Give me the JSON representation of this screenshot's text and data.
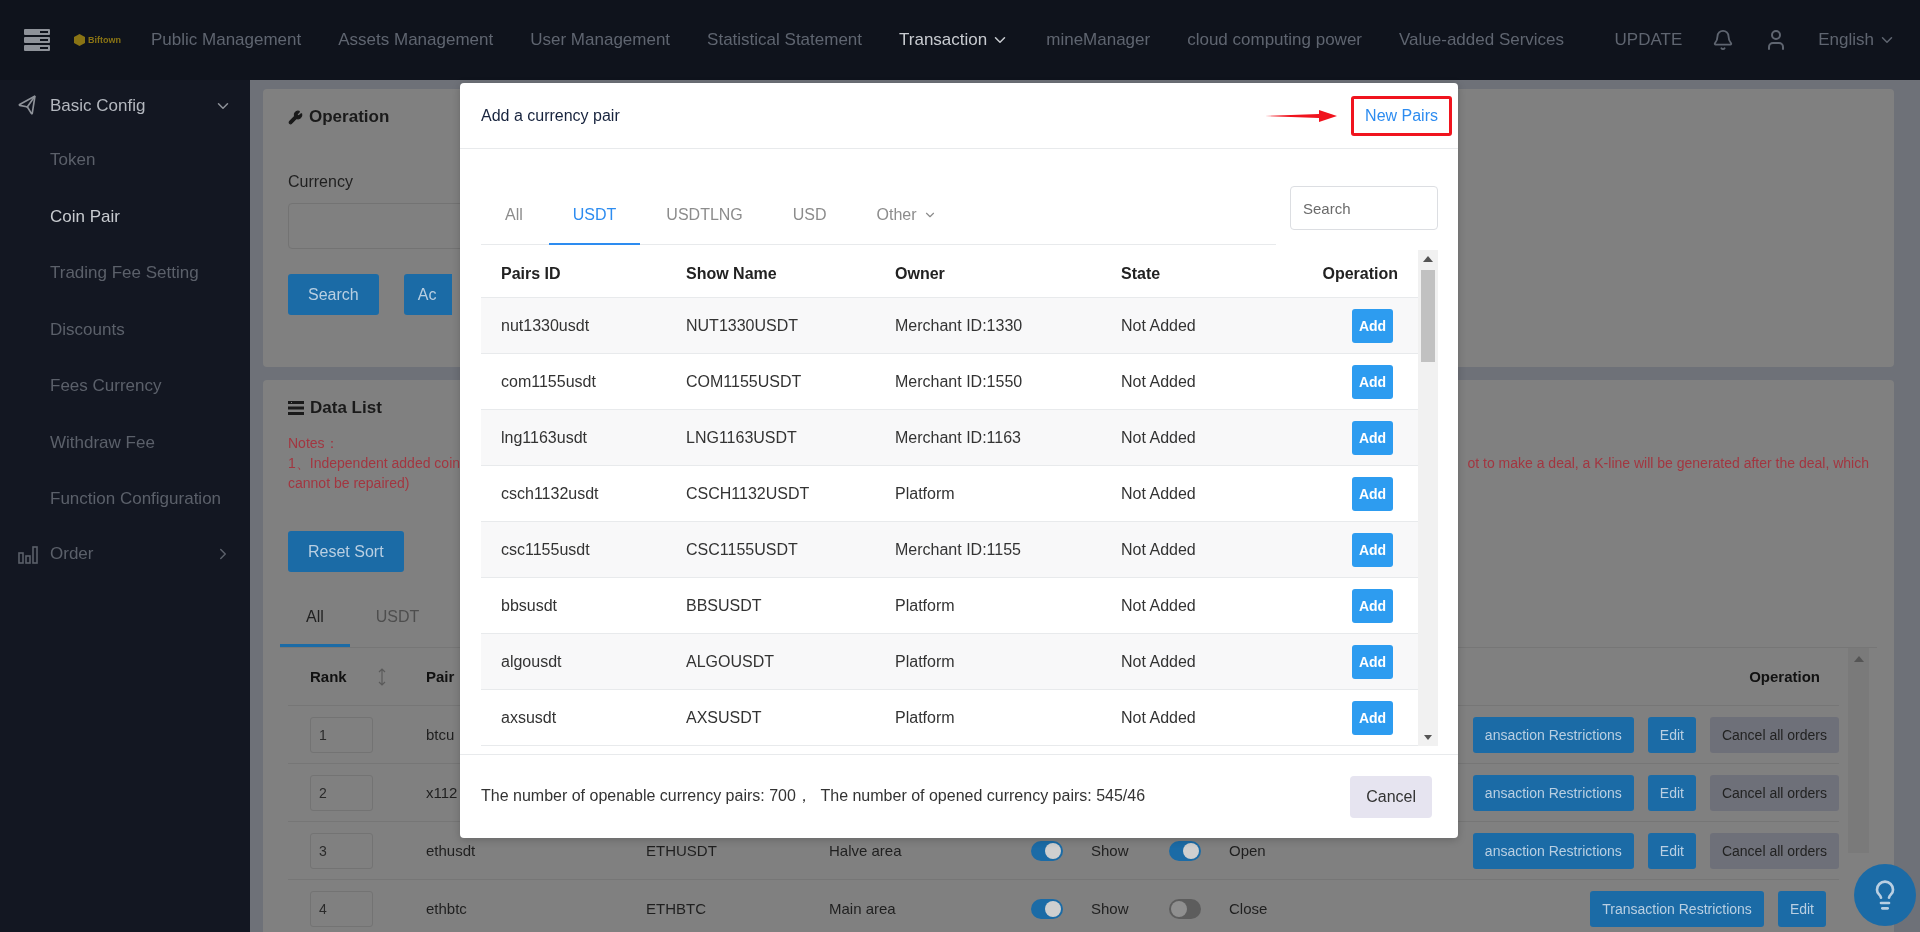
{
  "nav": {
    "logo_text": "Biftown",
    "menu": [
      {
        "label": "Public Management",
        "selected": false,
        "dropdown": false
      },
      {
        "label": "Assets Management",
        "selected": false,
        "dropdown": false
      },
      {
        "label": "User Management",
        "selected": false,
        "dropdown": false
      },
      {
        "label": "Statistical Statement",
        "selected": false,
        "dropdown": false
      },
      {
        "label": "Transaction",
        "selected": true,
        "dropdown": true
      },
      {
        "label": "mineManager",
        "selected": false,
        "dropdown": false
      },
      {
        "label": "cloud computing power",
        "selected": false,
        "dropdown": false
      },
      {
        "label": "Value-added Services",
        "selected": false,
        "dropdown": false
      }
    ],
    "update": "UPDATE",
    "language": "English"
  },
  "sidebar": {
    "groups": [
      {
        "label": "Basic Config",
        "expanded": true,
        "items": [
          {
            "label": "Token",
            "selected": false
          },
          {
            "label": "Coin Pair",
            "selected": true
          },
          {
            "label": "Trading Fee Setting",
            "selected": false
          },
          {
            "label": "Discounts",
            "selected": false
          },
          {
            "label": "Fees Currency",
            "selected": false
          },
          {
            "label": "Withdraw Fee",
            "selected": false
          },
          {
            "label": "Function Configuration",
            "selected": false
          }
        ]
      },
      {
        "label": "Order",
        "expanded": false
      }
    ]
  },
  "operation_panel": {
    "title": "Operation",
    "currency_label": "Currency",
    "buttons": [
      "Search",
      "Ac"
    ]
  },
  "data_panel": {
    "title": "Data List",
    "notes": {
      "heading": "Notes：",
      "line_1_left": "1、Independent added coin",
      "line_1_right": "ot to make a deal, a K-line will be generated after the deal, which",
      "line_2": "cannot be repaired)"
    },
    "reset_button": "Reset Sort",
    "tabs": [
      {
        "label": "All",
        "selected": true
      },
      {
        "label": "USDT",
        "selected": false
      }
    ],
    "columns": {
      "rank": "Rank",
      "pairs": "Pair",
      "operation": "Operation"
    },
    "rows": [
      {
        "rank": "1",
        "pair": "btcu",
        "actions": [
          {
            "label": "ansaction Restrictions",
            "kind": "primary"
          },
          {
            "label": "Edit",
            "kind": "primary"
          },
          {
            "label": "Cancel all orders",
            "kind": "secondary"
          }
        ]
      },
      {
        "rank": "2",
        "pair": "x112",
        "actions": [
          {
            "label": "ansaction Restrictions",
            "kind": "primary"
          },
          {
            "label": "Edit",
            "kind": "primary"
          },
          {
            "label": "Cancel all orders",
            "kind": "secondary"
          }
        ]
      },
      {
        "rank": "3",
        "pair": "ethusdt",
        "show_name": "ETHUSDT",
        "area": "Halve area",
        "show_toggle": {
          "on": true,
          "label": "Show"
        },
        "open_toggle": {
          "on": true,
          "label": "Open"
        },
        "actions": [
          {
            "label": "ansaction Restrictions",
            "kind": "primary"
          },
          {
            "label": "Edit",
            "kind": "primary"
          },
          {
            "label": "Cancel all orders",
            "kind": "secondary"
          }
        ]
      },
      {
        "rank": "4",
        "pair": "ethbtc",
        "show_name": "ETHBTC",
        "area": "Main area",
        "show_toggle": {
          "on": true,
          "label": "Show"
        },
        "open_toggle": {
          "on": false,
          "label": "Close"
        },
        "actions": [
          {
            "label": "Transaction Restrictions",
            "kind": "primary"
          },
          {
            "label": "Edit",
            "kind": "primary"
          }
        ]
      }
    ]
  },
  "modal": {
    "title": "Add a currency pair",
    "new_pairs_link": "New Pairs",
    "tabs": [
      {
        "label": "All",
        "selected": false,
        "dropdown": false
      },
      {
        "label": "USDT",
        "selected": true,
        "dropdown": false
      },
      {
        "label": "USDTLNG",
        "selected": false,
        "dropdown": false
      },
      {
        "label": "USD",
        "selected": false,
        "dropdown": false
      },
      {
        "label": "Other",
        "selected": false,
        "dropdown": true
      }
    ],
    "search": {
      "placeholder": "Search"
    },
    "columns": [
      "Pairs ID",
      "Show Name",
      "Owner",
      "State",
      "Operation"
    ],
    "rows": [
      {
        "pair_id": "nut1330usdt",
        "show_name": "NUT1330USDT",
        "owner": "Merchant ID:1330",
        "state": "Not Added",
        "action": "Add"
      },
      {
        "pair_id": "com1155usdt",
        "show_name": "COM1155USDT",
        "owner": "Merchant ID:1550",
        "state": "Not Added",
        "action": "Add"
      },
      {
        "pair_id": "lng1163usdt",
        "show_name": "LNG1163USDT",
        "owner": "Merchant ID:1163",
        "state": "Not Added",
        "action": "Add"
      },
      {
        "pair_id": "csch1132usdt",
        "show_name": "CSCH1132USDT",
        "owner": "Platform",
        "state": "Not Added",
        "action": "Add"
      },
      {
        "pair_id": "csc1155usdt",
        "show_name": "CSC1155USDT",
        "owner": "Merchant ID:1155",
        "state": "Not Added",
        "action": "Add"
      },
      {
        "pair_id": "bbsusdt",
        "show_name": "BBSUSDT",
        "owner": "Platform",
        "state": "Not Added",
        "action": "Add"
      },
      {
        "pair_id": "algousdt",
        "show_name": "ALGOUSDT",
        "owner": "Platform",
        "state": "Not Added",
        "action": "Add"
      },
      {
        "pair_id": "axsusdt",
        "show_name": "AXSUSDT",
        "owner": "Platform",
        "state": "Not Added",
        "action": "Add"
      }
    ],
    "footer_text": "The number of openable currency pairs: 700，  The number of opened currency pairs: 545/46",
    "cancel_button": "Cancel"
  }
}
